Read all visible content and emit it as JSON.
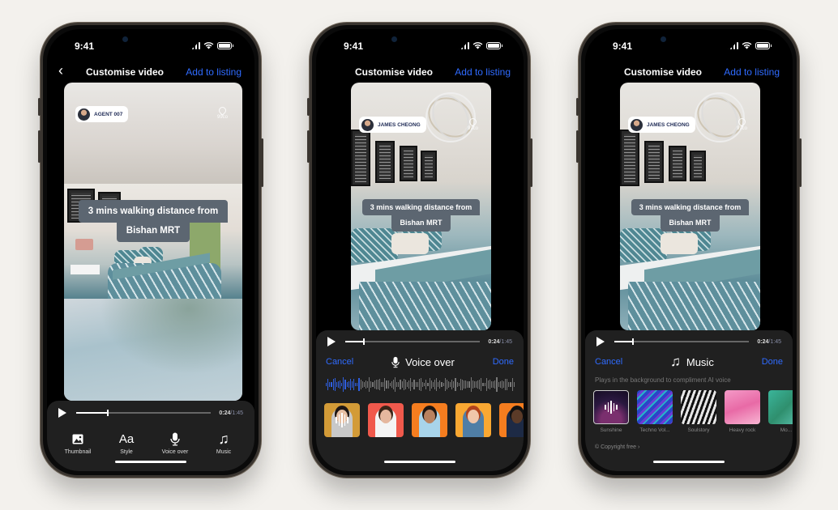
{
  "status_bar": {
    "time": "9:41"
  },
  "navbar": {
    "back_icon": "chevron-left-icon",
    "back_glyph": "‹",
    "title": "Customise video",
    "action": "Add to listing"
  },
  "colors": {
    "accent": "#2f6bff",
    "panel": "#202020",
    "caption_bg": "#5c6671",
    "background": "#f3f1ed"
  },
  "phones": [
    {
      "agent_name": "AGENT 007",
      "brand": "99co",
      "caption_line1": "3 mins walking distance from",
      "caption_line2": "Bishan MRT",
      "player": {
        "current": "0:24",
        "total": "/1:45",
        "progress": 0.23
      },
      "toolbar": [
        {
          "icon": "image-icon",
          "label": "Thumbnail"
        },
        {
          "icon": "text-style-icon",
          "glyph": "Aa",
          "label": "Style"
        },
        {
          "icon": "microphone-icon",
          "label": "Voice over"
        },
        {
          "icon": "music-note-icon",
          "glyph": "♫",
          "label": "Music"
        }
      ]
    },
    {
      "agent_name": "JAMES CHEONG",
      "brand": "99co",
      "caption_line1": "3 mins walking distance from",
      "caption_line2": "Bishan MRT",
      "player": {
        "current": "0:24",
        "total": "/1:45",
        "progress": 0.13
      },
      "sheet": {
        "cancel": "Cancel",
        "title": "Voice over",
        "title_icon": "microphone-icon",
        "done": "Done",
        "waveform_played": 0.18
      },
      "voices": [
        {
          "name": "voice-1",
          "bg": "#d39b37",
          "skin": "#e7c0a4",
          "hair": "#1d1613",
          "shirt": "#c8c8c8",
          "selected": true
        },
        {
          "name": "voice-2",
          "bg": "#f0594c",
          "skin": "#e5b79e",
          "hair": "#3a2518",
          "shirt": "#f4f4f4",
          "selected": false
        },
        {
          "name": "voice-3",
          "bg": "#f57d1f",
          "skin": "#b9825f",
          "hair": "#1e1510",
          "shirt": "#a8d4ea",
          "selected": false
        },
        {
          "name": "voice-4",
          "bg": "#f9a832",
          "skin": "#f0c6aa",
          "hair": "#b2421c",
          "shirt": "#4f7ea6",
          "selected": false
        },
        {
          "name": "voice-5",
          "bg": "#f57d1f",
          "skin": "#5b3b28",
          "hair": "#111",
          "shirt": "#1d2a45",
          "selected": false
        }
      ]
    },
    {
      "agent_name": "JAMES CHEONG",
      "brand": "99co",
      "caption_line1": "3 mins walking distance from",
      "caption_line2": "Bishan MRT",
      "player": {
        "current": "0:24",
        "total": "/1:45",
        "progress": 0.13
      },
      "sheet": {
        "cancel": "Cancel",
        "title": "Music",
        "title_icon": "music-note-icon",
        "title_glyph": "♫",
        "done": "Done",
        "subtitle": "Plays in the background to compliment AI voice",
        "copyright": "© Copyright free ›"
      },
      "tracks": [
        {
          "label": "Sunshine",
          "selected": true,
          "bg": "radial-gradient(circle at 50% 90%, #7a2f6e 0 30%, #2a1840 60%, #140c22 100%)"
        },
        {
          "label": "Techno Vol...",
          "selected": false,
          "bg": "repeating-linear-gradient(135deg, #2a46c7 0 4px, #6b3cd6 4px 7px, #28b3c9 7px 9px)"
        },
        {
          "label": "Soulstory",
          "selected": false,
          "bg": "repeating-linear-gradient(110deg, #111 0 3px, #e6e6e6 3px 6px)"
        },
        {
          "label": "Heavy rock",
          "selected": false,
          "bg": "linear-gradient(160deg, #f49ac7 0%, #e86aa6 50%, #f8b6d3 100%)"
        },
        {
          "label": "Mo...",
          "selected": false,
          "bg": "linear-gradient(135deg, #3ab59a 0%, #2f8f6e 50%, #5fc7b3 100%)"
        }
      ]
    }
  ]
}
